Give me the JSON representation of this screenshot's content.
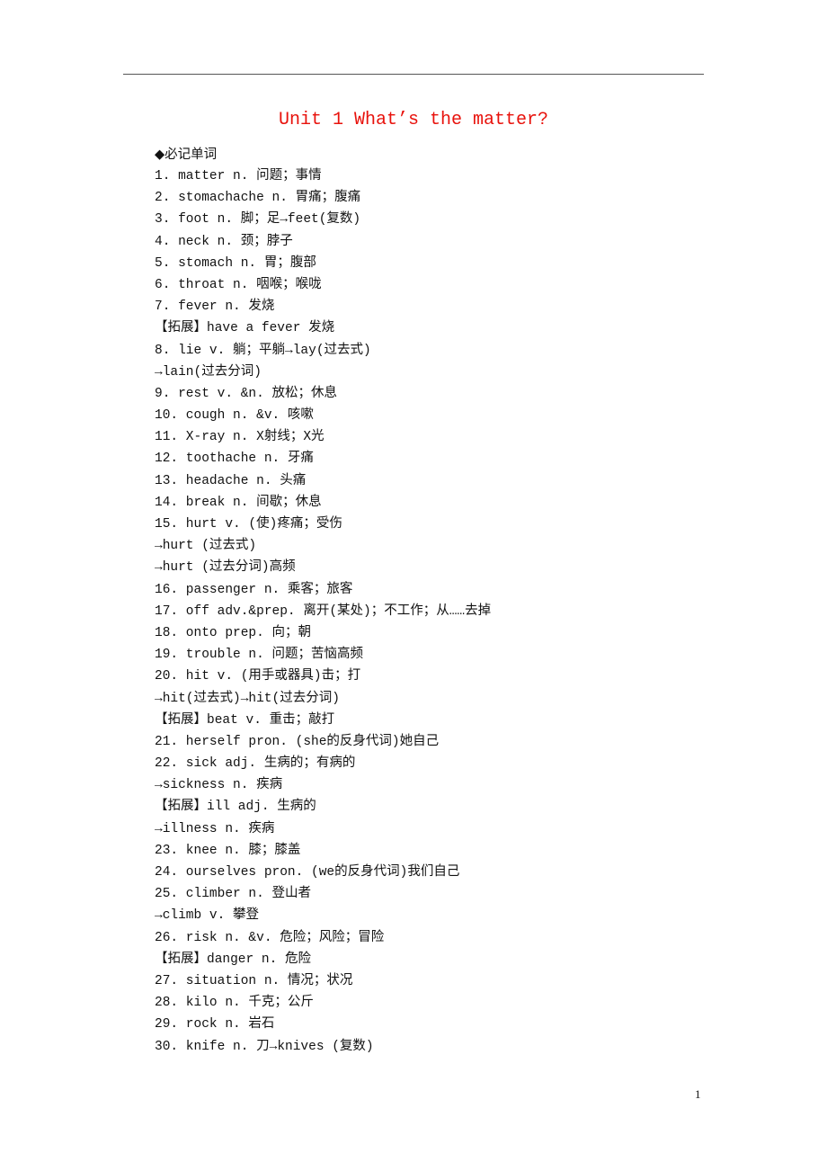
{
  "document": {
    "title": "Unit 1  What’s the matter?",
    "section_heading": "◆必记单词",
    "lines": [
      "1. matter n. 问题；事情",
      "2. stomachache n. 胃痛；腹痛",
      "3. foot n. 脚；足→feet(复数)",
      "4. neck n. 颈；脖子",
      "5. stomach n. 胃；腹部",
      "6. throat n. 咽喉；喉咙",
      "7. fever n. 发烧",
      "【拓展】have a fever 发烧",
      "8. lie v. 躺；平躺→lay(过去式)",
      "→lain(过去分词)",
      "9. rest v. &n. 放松；休息",
      "10. cough n. &v. 咳嗽",
      "11. X-ray n. X射线；X光",
      "12. toothache n. 牙痛",
      "13. headache n. 头痛",
      "14. break n. 间歇；休息",
      "15. hurt v. (使)疼痛；受伤",
      "→hurt (过去式)",
      "→hurt (过去分词)高频",
      "16. passenger n. 乘客；旅客",
      "17. off adv.&prep. 离开(某处)；不工作；从……去掉",
      "18. onto prep. 向；朝",
      "19. trouble n. 问题；苦恼高频",
      "20. hit v. (用手或器具)击；打",
      "→hit(过去式)→hit(过去分词)",
      "【拓展】beat v. 重击；敲打",
      "21. herself pron. (she的反身代词)她自己",
      "22. sick adj. 生病的；有病的",
      "→sickness n. 疾病",
      "【拓展】ill adj. 生病的",
      "→illness n. 疾病",
      "23. knee n. 膝；膝盖",
      "24. ourselves pron. (we的反身代词)我们自己",
      "25. climber n. 登山者",
      "→climb v. 攀登",
      "26. risk n. &v. 危险；风险；冒险",
      "【拓展】danger n. 危险",
      "27. situation n. 情况；状况",
      "28. kilo n. 千克；公斤",
      "29. rock n. 岩石",
      "30. knife n. 刀→knives (复数)"
    ],
    "page_number": "1"
  },
  "colors": {
    "title": "#e8120c",
    "text": "#111111",
    "rule": "#555555"
  }
}
